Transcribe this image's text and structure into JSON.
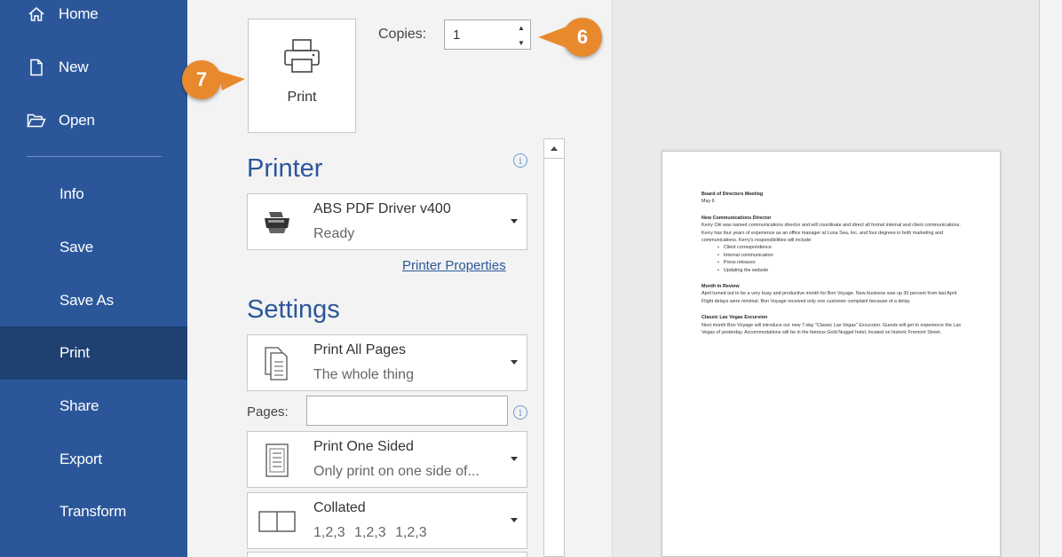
{
  "sidebar": {
    "items": [
      {
        "label": "Home",
        "icon": "home-icon"
      },
      {
        "label": "New",
        "icon": "new-document-icon"
      },
      {
        "label": "Open",
        "icon": "folder-open-icon"
      },
      {
        "label": "Info"
      },
      {
        "label": "Save"
      },
      {
        "label": "Save As"
      },
      {
        "label": "Print",
        "active": true
      },
      {
        "label": "Share"
      },
      {
        "label": "Export"
      },
      {
        "label": "Transform"
      }
    ]
  },
  "print_button": {
    "label": "Print",
    "icon": "printer-icon"
  },
  "copies": {
    "label": "Copies:",
    "value": "1"
  },
  "callouts": {
    "six": "6",
    "seven": "7"
  },
  "printer_section": {
    "title": "Printer",
    "printer_name": "ABS PDF Driver v400",
    "printer_status": "Ready",
    "properties_link": "Printer Properties"
  },
  "settings_section": {
    "title": "Settings",
    "pages_range": {
      "title": "Print All Pages",
      "subtitle": "The whole thing"
    },
    "pages_label": "Pages:",
    "sides": {
      "title": "Print One Sided",
      "subtitle": "Only print on one side of..."
    },
    "collation": {
      "title": "Collated",
      "subtitle": "1,2,3    1,2,3    1,2,3"
    }
  },
  "preview": {
    "heading": "Board of Directors Meeting",
    "date": "May 6",
    "s1_title": "New Communications Director",
    "s1_body": "Kerry Oki was named communications director and will coordinate and direct all formal internal and client communications. Kerry has four years of experience as an office manager at Luna Sea, Inc. and four degrees in both marketing and communications. Kerry's responsibilities will include:",
    "bullets": [
      "Client correspondence",
      "Internal communication",
      "Press releases",
      "Updating the website"
    ],
    "s2_title": "Month in Review",
    "s2_body": "April turned out to be a very busy and productive month for Bon Voyage. New business was up 30 percent from last April. Flight delays were minimal. Bon Voyage received only one customer complaint because of a delay.",
    "s3_title": "Classic Las Vegas Excursion",
    "s3_body": "Next month Bon Voyage will introduce our new 7-day \"Classic Las Vegas\" Excursion. Guests will get to experience the Las Vegas of yesterday. Accommodations will be in the famous Gold Nugget hotel, located on historic Fremont Street."
  },
  "colors": {
    "sidebar": "#2b579a",
    "sidebar_active": "#1e4172",
    "accent": "#e8892e"
  }
}
